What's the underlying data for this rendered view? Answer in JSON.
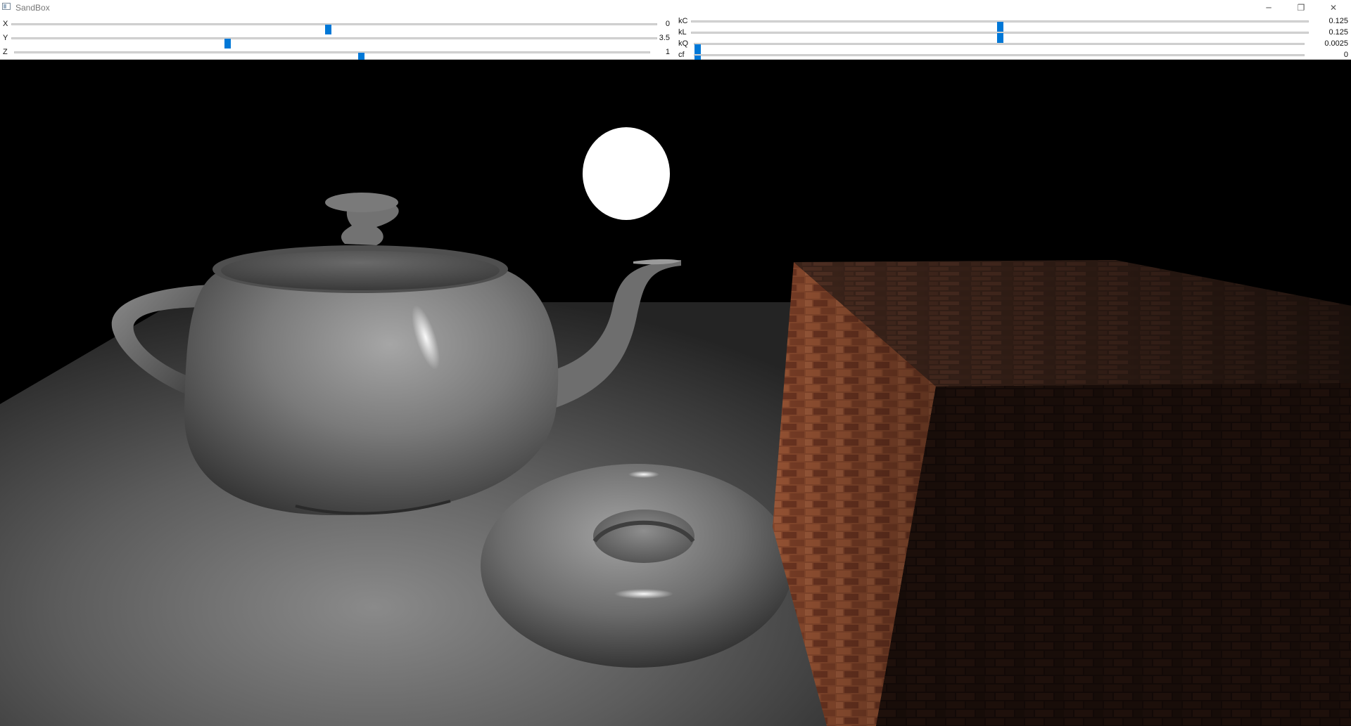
{
  "window": {
    "title": "SandBox",
    "minimize_glyph": "─",
    "maximize_glyph": "❐",
    "close_glyph": "✕"
  },
  "sliders_left": [
    {
      "label": "X",
      "value_text": "0",
      "fraction": 0.49
    },
    {
      "label": "Y",
      "value_text": "3.5",
      "fraction": 0.334
    },
    {
      "label": "Z",
      "value_text": "1",
      "fraction": 0.546
    }
  ],
  "sliders_right": [
    {
      "label": "kC",
      "value_text": "0.125",
      "fraction": 0.5
    },
    {
      "label": "kL",
      "value_text": "0.125",
      "fraction": 0.5
    },
    {
      "label": "kQ",
      "value_text": "0.0025",
      "fraction": 0.0
    },
    {
      "label": "cf",
      "value_text": "0",
      "fraction": 0.0
    }
  ],
  "colors": {
    "accent": "#0078d7",
    "background": "#000000",
    "floor": "#6e6e6e",
    "brick": "#7a3a22"
  },
  "scene": {
    "icons": [
      "teapot",
      "torus",
      "light-sphere",
      "brick-cube",
      "floor-plane"
    ]
  }
}
